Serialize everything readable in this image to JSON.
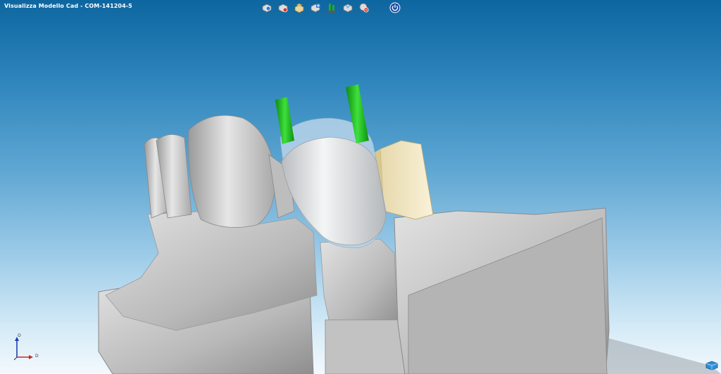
{
  "window": {
    "title": "Visualizza Modello Cad  - COM-141204-5"
  },
  "toolbar": {
    "buttons": [
      {
        "icon": "view-model-icon",
        "accent": "#2a7ad6"
      },
      {
        "icon": "hide-model-icon",
        "accent": "#d23a2a"
      },
      {
        "icon": "antagonist-icon",
        "accent": "#d9b56a"
      },
      {
        "icon": "add-model-icon",
        "accent": "#2a7ad6"
      },
      {
        "icon": "green-sprue-icon",
        "accent": "#1faa2e"
      },
      {
        "icon": "edit-model-icon",
        "accent": "#6aa8e0"
      },
      {
        "icon": "remove-model-icon",
        "accent": "#d23a2a"
      },
      {
        "icon": "power-icon",
        "accent": "#1d4fa8"
      }
    ]
  },
  "axes": {
    "vertical": "O",
    "horizontal": "D"
  },
  "colors": {
    "model": "#c9c9c9",
    "crown": "#e6e6e6",
    "sprue": "#1fb21f",
    "block": "#f2e6c2"
  }
}
